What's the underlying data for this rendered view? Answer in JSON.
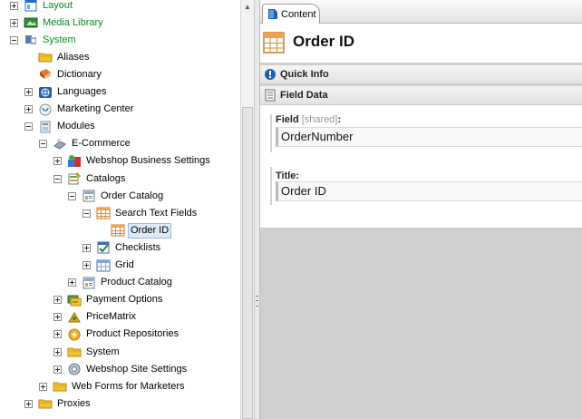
{
  "tree": {
    "items": [
      {
        "label": "Layout",
        "icon": "layout-icon",
        "toggle": "plus",
        "depth": 0,
        "green": true
      },
      {
        "label": "Media Library",
        "icon": "media-library-icon",
        "toggle": "plus",
        "depth": 0,
        "green": true
      },
      {
        "label": "System",
        "icon": "system-icon",
        "toggle": "minus",
        "depth": 0,
        "green": true
      },
      {
        "label": "Aliases",
        "icon": "folder-icon",
        "toggle": "none",
        "depth": 1
      },
      {
        "label": "Dictionary",
        "icon": "dictionary-icon",
        "toggle": "none",
        "depth": 1
      },
      {
        "label": "Languages",
        "icon": "languages-icon",
        "toggle": "plus",
        "depth": 1
      },
      {
        "label": "Marketing Center",
        "icon": "marketing-center-icon",
        "toggle": "plus",
        "depth": 1
      },
      {
        "label": "Modules",
        "icon": "modules-icon",
        "toggle": "minus",
        "depth": 1
      },
      {
        "label": "E-Commerce",
        "icon": "ecommerce-icon",
        "toggle": "minus",
        "depth": 2
      },
      {
        "label": "Webshop Business Settings",
        "icon": "business-settings-icon",
        "toggle": "plus",
        "depth": 3
      },
      {
        "label": "Catalogs",
        "icon": "catalogs-icon",
        "toggle": "minus",
        "depth": 3
      },
      {
        "label": "Order Catalog",
        "icon": "catalog-icon",
        "toggle": "minus",
        "depth": 4
      },
      {
        "label": "Search Text Fields",
        "icon": "grid-orange-icon",
        "toggle": "minus",
        "depth": 5
      },
      {
        "label": "Order ID",
        "icon": "grid-orange-icon",
        "toggle": "none",
        "depth": 6,
        "selected": true
      },
      {
        "label": "Checklists",
        "icon": "checklist-icon",
        "toggle": "plus",
        "depth": 5
      },
      {
        "label": "Grid",
        "icon": "grid-icon",
        "toggle": "plus",
        "depth": 5
      },
      {
        "label": "Product Catalog",
        "icon": "catalog-icon",
        "toggle": "plus",
        "depth": 4
      },
      {
        "label": "Payment Options",
        "icon": "payment-icon",
        "toggle": "plus",
        "depth": 3
      },
      {
        "label": "PriceMatrix",
        "icon": "price-matrix-icon",
        "toggle": "plus",
        "depth": 3
      },
      {
        "label": "Product Repositories",
        "icon": "repository-icon",
        "toggle": "plus",
        "depth": 3
      },
      {
        "label": "System",
        "icon": "folder-icon",
        "toggle": "plus",
        "depth": 3
      },
      {
        "label": "Webshop Site Settings",
        "icon": "site-settings-icon",
        "toggle": "plus",
        "depth": 3
      },
      {
        "label": "Web Forms for Marketers",
        "icon": "folder-icon",
        "toggle": "plus",
        "depth": 2
      },
      {
        "label": "Proxies",
        "icon": "folder-icon",
        "toggle": "plus",
        "depth": 1
      }
    ]
  },
  "content": {
    "tab_label": "Content",
    "title": "Order ID",
    "sections": {
      "quick_info": "Quick Info",
      "field_data": "Field Data"
    },
    "fields": {
      "field_label": "Field",
      "field_shared": "[shared]",
      "field_colon": ":",
      "field_value": "OrderNumber",
      "title_label": "Title:",
      "title_value": "Order ID"
    }
  },
  "colors": {
    "tree_green": "#0a8a1f",
    "selection": "#dde9f7",
    "content_bg": "#cfcfcf"
  }
}
